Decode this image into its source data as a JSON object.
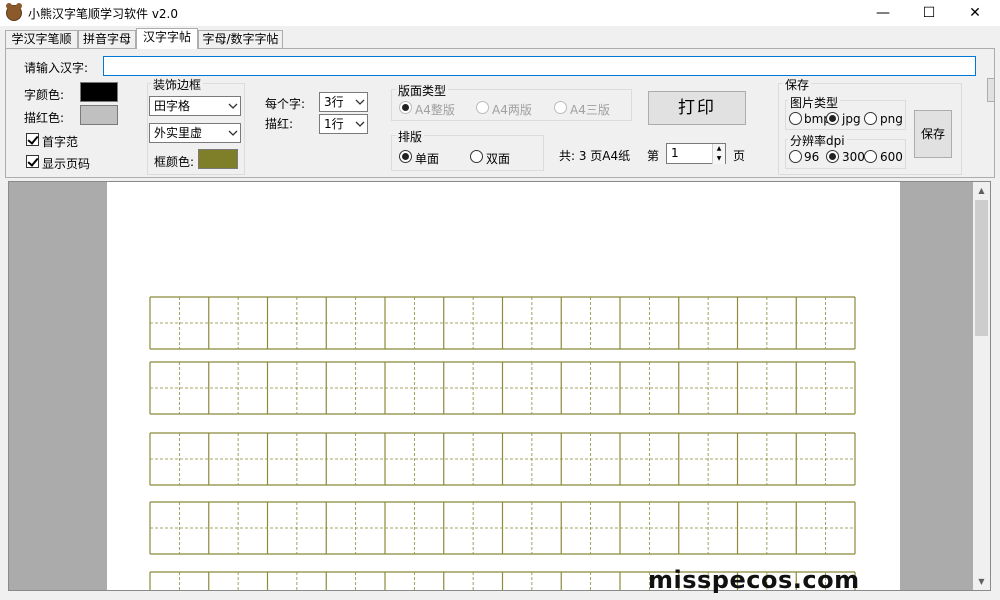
{
  "window": {
    "title": "小熊汉字笔顺学习软件 v2.0",
    "minimize": "—",
    "maximize": "☐",
    "close": "✕"
  },
  "tabs": [
    {
      "label": "学汉字笔顺",
      "active": false
    },
    {
      "label": "拼音字母",
      "active": false
    },
    {
      "label": "汉字字帖",
      "active": true
    },
    {
      "label": "字母/数字字帖",
      "active": false
    }
  ],
  "input": {
    "label": "请输入汉字:",
    "value": ""
  },
  "colors": {
    "char_label": "字颜色:",
    "char_color": "#000000",
    "trace_label": "描红色:",
    "trace_color": "#c0c0c0",
    "frame_color": "#7f7f2a",
    "grid_color": "#8b8b3a"
  },
  "checkboxes": {
    "first_example": "首字范",
    "show_page_number": "显示页码"
  },
  "border_group": {
    "title": "装饰边框",
    "grid_type": "田字格",
    "line_style": "外实里虚",
    "frame_color_label": "框颜色:"
  },
  "per_char": {
    "label": "每个字:",
    "value": "3行",
    "trace_label": "描红:",
    "trace_value": "1行"
  },
  "page_type": {
    "title": "版面类型",
    "options": [
      "A4整版",
      "A4两版",
      "A4三版"
    ]
  },
  "layout": {
    "title": "排版",
    "options": [
      "单面",
      "双面"
    ]
  },
  "print": {
    "label": "打印",
    "total": "共: 3 页A4纸",
    "page_prefix": "第",
    "page_value": "1",
    "page_suffix": "页"
  },
  "save_group": {
    "title": "保存",
    "image_type_title": "图片类型",
    "image_types": [
      "bmp",
      "jpg",
      "png"
    ],
    "dpi_title": "分辨率dpi",
    "dpis": [
      "96",
      "300",
      "600"
    ],
    "save_button": "保存"
  },
  "watermark": "misspecos.com"
}
